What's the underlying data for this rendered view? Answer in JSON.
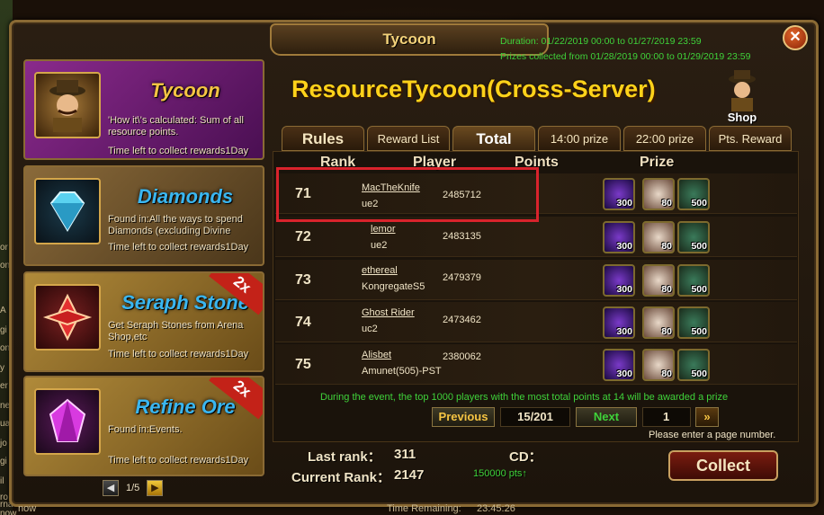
{
  "window": {
    "title": "Tycoon",
    "close_label": "✕",
    "duration": "Duration: 01/22/2019 00:00 to 01/27/2019 23:59",
    "prizes_collected": "Prizes collected from 01/28/2019 00:00 to 01/29/2019 23:59"
  },
  "backdrop": {
    "left_fragments": [
      "or",
      "on",
      "A",
      "gi",
      "on",
      "y",
      "er",
      "ne",
      "ua",
      "jo",
      "gi",
      "il",
      "ro",
      "rna",
      "now"
    ],
    "bottom_fragments": [
      "now",
      "Time Remaining:",
      "23:45:26"
    ]
  },
  "cards": [
    {
      "name": "Tycoon",
      "desc": "'How it\\'s calculated: Sum of all resource points.",
      "time": "Time left to collect rewards1Day",
      "badge": ""
    },
    {
      "name": "Diamonds",
      "desc": "Found in:All the ways to spend Diamonds (excluding Divine",
      "time": "Time left to collect rewards1Day",
      "badge": ""
    },
    {
      "name": "Seraph Stone",
      "desc": "Get Seraph Stones from Arena Shop,etc",
      "time": "Time left to collect rewards1Day",
      "badge": "2x"
    },
    {
      "name": "Refine Ore",
      "desc": "Found in:Events.",
      "time": "Time left to collect rewards1Day",
      "badge": "2x"
    }
  ],
  "left_pager": {
    "prev": "◀",
    "page": "1/5",
    "next": "▶"
  },
  "main": {
    "title": "ResourceTycoon(Cross-Server)",
    "shop_label": "Shop",
    "tabs": [
      "Rules",
      "Reward List",
      "Total",
      "14:00 prize",
      "22:00 prize",
      "Pts. Reward"
    ],
    "active_tab": "Total",
    "columns": [
      "Rank",
      "Player",
      "Points",
      "Prize"
    ],
    "rows": [
      {
        "rank": "71",
        "player": "MacTheKnife",
        "server": "ue2",
        "points": "2485712",
        "prizes": [
          "300",
          "80",
          "500"
        ]
      },
      {
        "rank": "72",
        "player": "lemor",
        "server": "ue2",
        "points": "2483135",
        "prizes": [
          "300",
          "80",
          "500"
        ]
      },
      {
        "rank": "73",
        "player": "ethereal",
        "server": "KongregateS5",
        "points": "2479379",
        "prizes": [
          "300",
          "80",
          "500"
        ]
      },
      {
        "rank": "74",
        "player": "Ghost Rider",
        "server": "uc2",
        "points": "2473462",
        "prizes": [
          "300",
          "80",
          "500"
        ]
      },
      {
        "rank": "75",
        "player": "Alisbet",
        "server": "Amunet(505)-PST",
        "points": "2380062",
        "prizes": [
          "300",
          "80",
          "500"
        ]
      }
    ],
    "note": "During the event, the top 1000 players with the most total points at 14 will be awarded a prize",
    "pagination": {
      "previous": "Previous",
      "page": "15/201",
      "next": "Next",
      "input_value": "1",
      "go": "»",
      "hint": "Please enter a page number."
    },
    "last_rank_label": "Last rank：",
    "last_rank_value": "311",
    "current_rank_label": "Current Rank：",
    "current_rank_value": "2147",
    "cd_label": "CD：",
    "cd_sub": "150000 pts↑",
    "collect_label": "Collect"
  },
  "colors": {
    "accent_gold": "#ffd21a",
    "highlight_red": "#d9232c",
    "green_text": "#3fd23a"
  }
}
